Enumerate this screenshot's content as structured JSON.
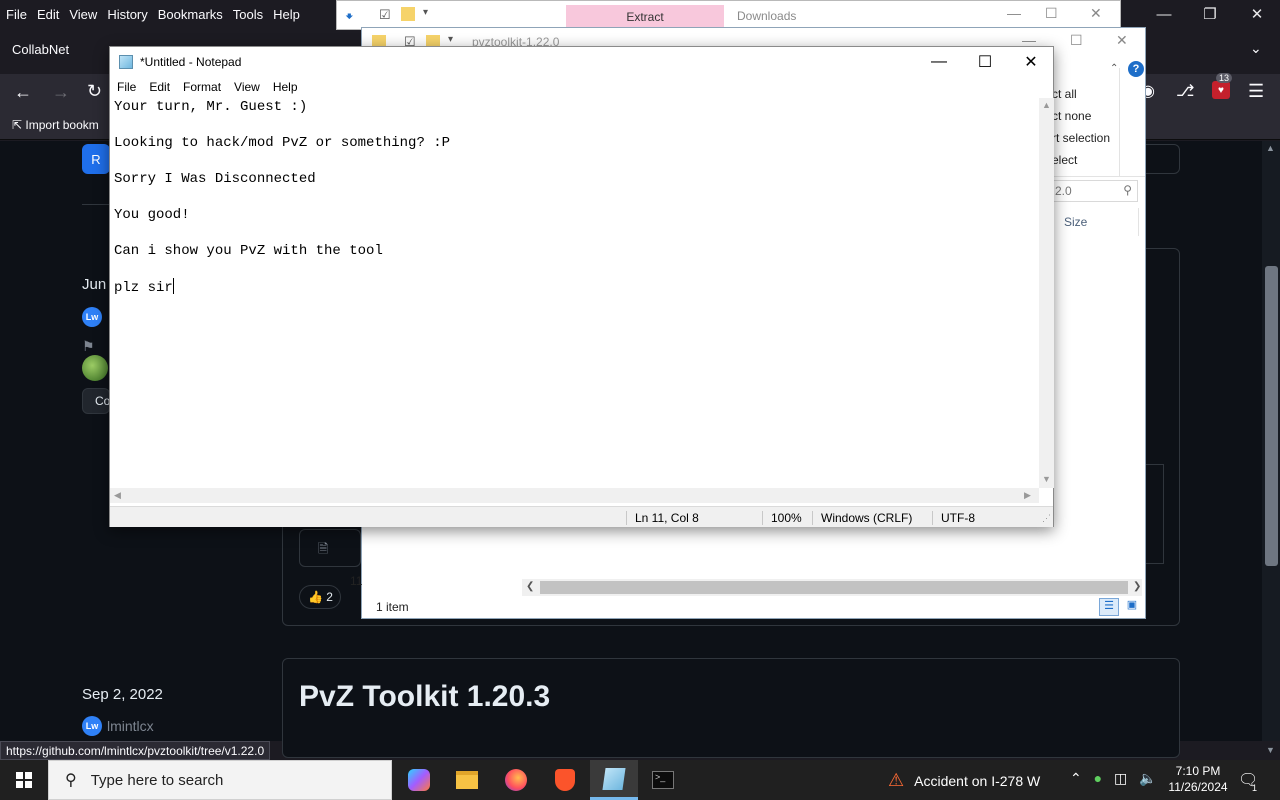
{
  "firefox": {
    "menu": [
      "File",
      "Edit",
      "View",
      "History",
      "Bookmarks",
      "Tools",
      "Help"
    ],
    "tab_title": "CollabNet",
    "bookmark_label": "Import bookm",
    "release_date": "Sep 2, 2022",
    "release_title": "PvZ Toolkit 1.20.3",
    "author": "lmintlcx",
    "avatar_initials": "Lw",
    "side_date": "Jun",
    "reaction_count": "2",
    "status_url": "https://github.com/lmintlcx/pvztoolkit/tree/v1.22.0",
    "extension_badge": "13",
    "button_partial": "R",
    "copy_partial": "Co"
  },
  "explorer_back": {
    "extract_tab": "Extract",
    "downloads_label": "Downloads"
  },
  "explorer": {
    "title": "pvztoolkit-1.22.0",
    "ribbon_items": [
      "ct all",
      "ct none",
      "rt selection",
      "elect"
    ],
    "search_value": "2.0",
    "size_column": "Size",
    "status": "1 item",
    "partial_row": "11"
  },
  "notepad": {
    "title": "*Untitled - Notepad",
    "menu": [
      "File",
      "Edit",
      "Format",
      "View",
      "Help"
    ],
    "lines": [
      "Your turn, Mr. Guest :)",
      "",
      "Looking to hack/mod PvZ or something? :P",
      "",
      "Sorry I Was Disconnected",
      "",
      "You good!",
      "",
      "Can i show you PvZ with the tool",
      "",
      "plz sir"
    ],
    "status": {
      "position": "Ln 11, Col 8",
      "zoom": "100%",
      "line_ending": "Windows (CRLF)",
      "encoding": "UTF-8"
    }
  },
  "taskbar": {
    "search_placeholder": "Type here to search",
    "news": "Accident on I-278 W",
    "time": "7:10 PM",
    "date": "11/26/2024",
    "notification_count": "1"
  }
}
